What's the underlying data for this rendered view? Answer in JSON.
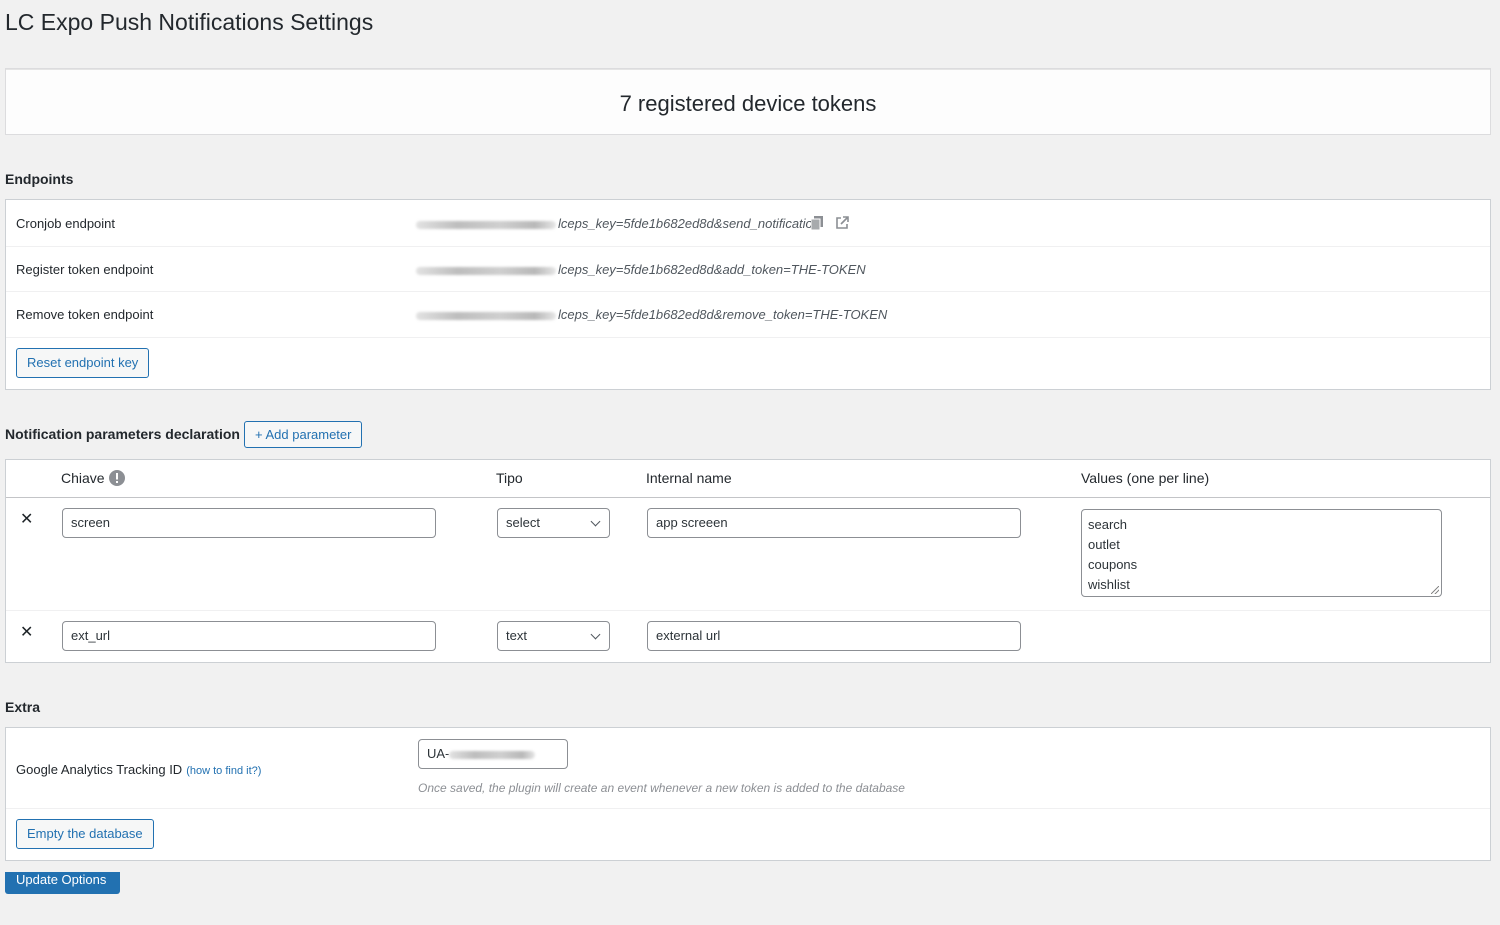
{
  "page": {
    "title": "LC Expo Push Notifications Settings"
  },
  "tokens": {
    "summary": "7 registered device tokens"
  },
  "endpoints": {
    "section_title": "Endpoints",
    "rows": [
      {
        "label": "Cronjob endpoint",
        "value": "lceps_key=5fde1b682ed8d&send_notification"
      },
      {
        "label": "Register token endpoint",
        "value": "lceps_key=5fde1b682ed8d&add_token=THE-TOKEN"
      },
      {
        "label": "Remove token endpoint",
        "value": "lceps_key=5fde1b682ed8d&remove_token=THE-TOKEN"
      }
    ],
    "reset_button": "Reset endpoint key",
    "copy_icon": "copy-icon",
    "external_link_icon": "external-link-icon"
  },
  "params": {
    "section_title": "Notification parameters declaration",
    "add_button": "+ Add parameter",
    "headers": {
      "key": "Chiave",
      "type": "Tipo",
      "internal": "Internal name",
      "values": "Values (one per line)"
    },
    "info_icon": "info-icon",
    "delete_icon": "close-icon",
    "delete_glyph": "✕",
    "rows": [
      {
        "key": "screen",
        "type": "select",
        "internal": "app screeen",
        "values": [
          "search",
          "outlet",
          "coupons",
          "wishlist"
        ]
      },
      {
        "key": "ext_url",
        "type": "text",
        "internal": "external url"
      }
    ]
  },
  "extra": {
    "section_title": "Extra",
    "ga_label": "Google Analytics Tracking ID",
    "ga_link": "(how to find it?)",
    "ga_value": "UA-",
    "ga_hint": "Once saved, the plugin will create an event whenever a new token is added to the database",
    "empty_button": "Empty the database"
  },
  "submit": {
    "label": "Update Options"
  },
  "colors": {
    "accent": "#2271b1",
    "background": "#f1f1f1",
    "text": "#23282d"
  }
}
